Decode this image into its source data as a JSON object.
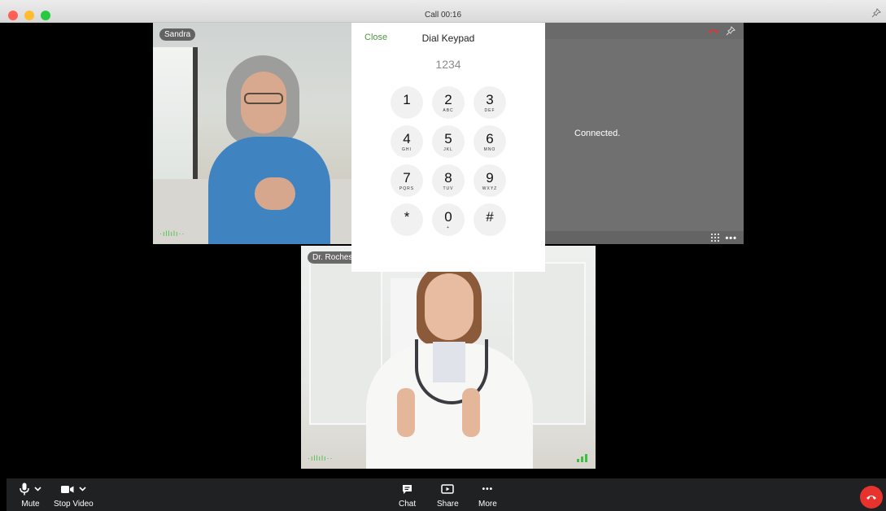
{
  "window": {
    "title": "Call 00:16"
  },
  "tiles": {
    "sandra": {
      "name": "Sandra",
      "audio_meter": "·ıllılı··"
    },
    "phone": {
      "status": "Connected.",
      "more": "•••"
    },
    "roches": {
      "name": "Dr. Roches",
      "audio_meter": "·ıllılı··"
    }
  },
  "keypad": {
    "close_label": "Close",
    "title": "Dial Keypad",
    "display": "1234",
    "keys": [
      {
        "digit": "1",
        "letters": ""
      },
      {
        "digit": "2",
        "letters": "ABC"
      },
      {
        "digit": "3",
        "letters": "DEF"
      },
      {
        "digit": "4",
        "letters": "GHI"
      },
      {
        "digit": "5",
        "letters": "JKL"
      },
      {
        "digit": "6",
        "letters": "MNO"
      },
      {
        "digit": "7",
        "letters": "PQRS"
      },
      {
        "digit": "8",
        "letters": "TUV"
      },
      {
        "digit": "9",
        "letters": "WXYZ"
      },
      {
        "digit": "*",
        "letters": ""
      },
      {
        "digit": "0",
        "letters": "+"
      },
      {
        "digit": "#",
        "letters": ""
      }
    ]
  },
  "toolbar": {
    "mute_label": "Mute",
    "stop_video_label": "Stop Video",
    "chat_label": "Chat",
    "share_label": "Share",
    "more_label": "More",
    "more_icon_text": "•••"
  },
  "colors": {
    "accent_green": "#4a9a3e",
    "end_call_red": "#e8322e",
    "toolbar_bg": "#202123"
  },
  "icons": [
    "microphone-icon",
    "video-camera-icon",
    "chevron-down-icon",
    "chat-icon",
    "share-screen-icon",
    "more-icon",
    "end-call-icon",
    "pin-icon",
    "keypad-grid-icon"
  ]
}
